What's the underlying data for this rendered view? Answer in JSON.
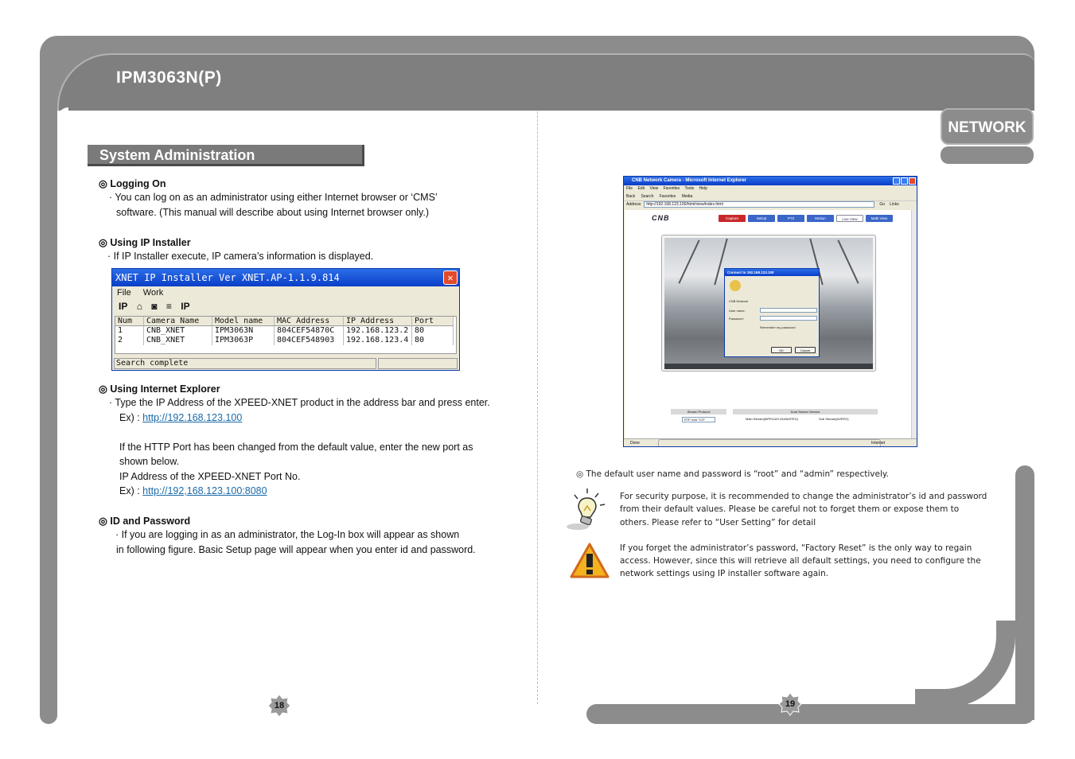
{
  "header": {
    "doc_title": "IPM3063N(P)",
    "network_tab": "NETWORK"
  },
  "left_page": {
    "section_title": "System Administration",
    "logging_on": {
      "heading": "◎ Logging On",
      "line1": "· You can log on as an administrator using either Internet browser or ‘CMS’",
      "line2": "software. (This manual will describe about using Internet browser only.)"
    },
    "ip_installer": {
      "heading": "◎ Using IP Installer",
      "line1": "· If IP Installer execute, IP camera’s information is displayed."
    },
    "installer_window": {
      "title": "XNET IP Installer Ver XNET.AP-1.1.9.814",
      "close_label": "✕",
      "menu": [
        "File",
        "Work"
      ],
      "tools": [
        "IP",
        "⌂",
        "◙",
        "≡",
        "IP"
      ],
      "columns": [
        "Num",
        "Camera Name",
        "Model name",
        "MAC Address",
        "IP Address",
        "Port"
      ],
      "rows": [
        [
          "1",
          "CNB_XNET",
          "IPM3063N",
          "804CEF54870C",
          "192.168.123.2",
          "80"
        ],
        [
          "2",
          "CNB_XNET",
          "IPM3063P",
          "804CEF548903",
          "192.168.123.4",
          "80"
        ]
      ],
      "status": "Search complete"
    },
    "internet_explorer": {
      "heading": "◎ Using Internet Explorer",
      "line1": "· Type the IP Address of the XPEED-XNET product in the address bar and press enter.",
      "ex1_prefix": "Ex) : ",
      "ex1_link": "http://192.168.123.100",
      "line2": "If the HTTP Port has been changed from the default value, enter the new port as",
      "line3": "shown below.",
      "line4": "IP Address of the XPEED-XNET Port No.",
      "ex2_prefix": "Ex) : ",
      "ex2_link": "http://192,168.123.100:8080"
    },
    "id_password": {
      "heading": "◎  ID and Password",
      "line1": "· If you are logging in as an administrator, the Log-In box will appear as shown",
      "line2": "in following figure. Basic Setup page will appear when you enter id and password."
    },
    "page_number": "18"
  },
  "right_page": {
    "ie_window": {
      "title": "CNB Network Camera - Microsoft Internet Explorer",
      "menu": [
        "File",
        "Edit",
        "View",
        "Favorites",
        "Tools",
        "Help"
      ],
      "toolbar": [
        "Back",
        "Search",
        "Favorites",
        "Media"
      ],
      "address_label": "Address",
      "address": "http://192.168.123.100/html/view/index.html",
      "go": "Go",
      "links": "Links",
      "logo": "CNB",
      "nav": [
        "Capture",
        "SetUp",
        "PTZ",
        "Motion",
        "Live View",
        "Multi View"
      ],
      "dialog_title": "Connect to 192.168.123.100",
      "dialog_realm": "CNB Network",
      "dialog_user_label": "User name:",
      "dialog_pass_label": "Password:",
      "dialog_remember": "Remember my password",
      "dialog_ok": "OK",
      "dialog_cancel": "Cancel",
      "stream_protocol": "Stream Protocol",
      "dual_stream": "Dual Stream Service",
      "protocol_value": "RTP over TCP",
      "main_stream": "Main Stream(MPEG4/H.264/MJPEG)",
      "sub_stream": "Sub Stream(MJPEG)",
      "status_done": "Done",
      "status_zone": "Internet"
    },
    "default_login": "◎ The default user name and password is “root” and “admin” respectively.",
    "tip": {
      "line1": "For security purpose, it is recommended to change the administrator’s id and password",
      "line2": "from their default values. Please be careful not to forget them or expose them to",
      "line3": "others. Please refer to “User Setting” for detail"
    },
    "warning": {
      "line1": "If you forget the administrator’s password, “Factory Reset” is the only way to regain",
      "line2": "access. However, since this will retrieve all default settings, you need to configure the",
      "line3": "network settings using IP installer software again."
    },
    "page_number": "19"
  }
}
